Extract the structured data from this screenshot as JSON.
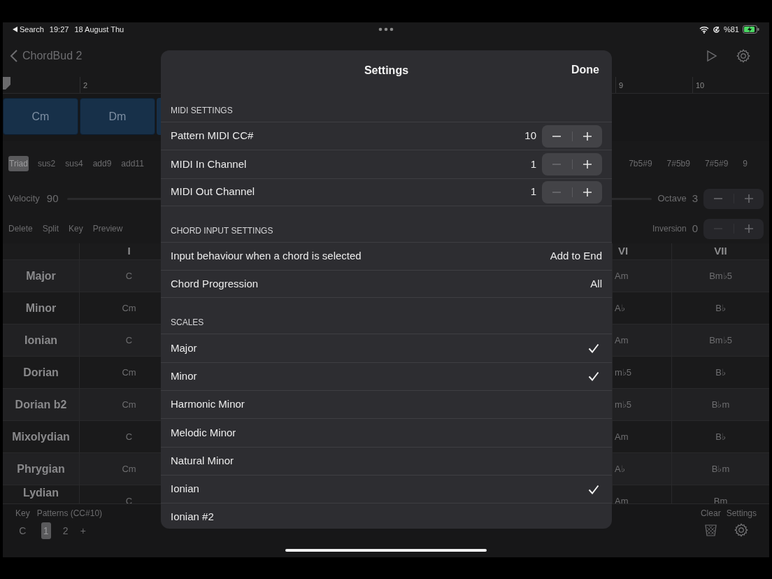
{
  "status_bar": {
    "back": "Search",
    "time": "19:27",
    "date": "18 August Thu",
    "battery": "%81"
  },
  "nav": {
    "back": "ChordBud 2"
  },
  "timeline": {
    "left_bars": [
      "2"
    ],
    "right_bars": [
      "9",
      "10"
    ],
    "chords": [
      "Cm",
      "Dm"
    ]
  },
  "chord_types_left": [
    {
      "label": "Triad",
      "selected": true
    },
    {
      "label": "sus2",
      "selected": false
    },
    {
      "label": "sus4",
      "selected": false
    },
    {
      "label": "add9",
      "selected": false
    },
    {
      "label": "add11",
      "selected": false
    }
  ],
  "chord_types_right": [
    {
      "label": "7b5#9",
      "selected": false
    },
    {
      "label": "7#5b9",
      "selected": false
    },
    {
      "label": "7#5#9",
      "selected": false
    },
    {
      "label": "9",
      "selected": false
    }
  ],
  "velocity": {
    "label": "Velocity",
    "value": "90"
  },
  "octave": {
    "label": "Octave",
    "value": "3",
    "minus_disabled": false
  },
  "inversion": {
    "label": "Inversion",
    "value": "0",
    "minus_disabled": true
  },
  "edit_actions": [
    "Delete",
    "Split",
    "Key",
    "Preview"
  ],
  "table": {
    "columns_left": [
      "I"
    ],
    "columns_right": [
      "VI",
      "VII"
    ],
    "rows": [
      {
        "name": "Major",
        "left": [
          "C"
        ],
        "right": [
          "Am",
          "Bm♭5"
        ]
      },
      {
        "name": "Minor",
        "left": [
          "Cm"
        ],
        "right": [
          "A♭",
          "B♭"
        ]
      },
      {
        "name": "Ionian",
        "left": [
          "C"
        ],
        "right": [
          "Am",
          "Bm♭5"
        ]
      },
      {
        "name": "Dorian",
        "left": [
          "Cm"
        ],
        "right": [
          "m♭5",
          "B♭"
        ]
      },
      {
        "name": "Dorian b2",
        "left": [
          "Cm"
        ],
        "right": [
          "m♭5",
          "B♭m"
        ]
      },
      {
        "name": "Mixolydian",
        "left": [
          "C"
        ],
        "right": [
          "Am",
          "B♭"
        ]
      },
      {
        "name": "Phrygian",
        "left": [
          "Cm"
        ],
        "right": [
          "A♭",
          "B♭m"
        ]
      },
      {
        "name": "Lydian",
        "left": [
          "C"
        ],
        "right": [
          "Am",
          "Bm"
        ]
      }
    ]
  },
  "bottom_bar": {
    "key_label": "Key",
    "key": "C",
    "patterns_label": "Patterns (CC#10)",
    "patterns": [
      {
        "label": "1",
        "selected": true
      },
      {
        "label": "2",
        "selected": false
      }
    ],
    "add": "+",
    "clear": "Clear",
    "settings": "Settings"
  },
  "settings_sheet": {
    "title": "Settings",
    "done": "Done",
    "sections": [
      {
        "header": "MIDI SETTINGS",
        "rows": [
          {
            "kind": "stepper",
            "label": "Pattern MIDI CC#",
            "value": "10",
            "minus_disabled": false
          },
          {
            "kind": "stepper",
            "label": "MIDI In Channel",
            "value": "1",
            "minus_disabled": true
          },
          {
            "kind": "stepper",
            "label": "MIDI Out Channel",
            "value": "1",
            "minus_disabled": true
          }
        ]
      },
      {
        "header": "CHORD INPUT SETTINGS",
        "rows": [
          {
            "kind": "value",
            "label": "Input behaviour when a chord is selected",
            "value": "Add to End"
          },
          {
            "kind": "value",
            "label": "Chord Progression",
            "value": "All"
          }
        ]
      },
      {
        "header": "SCALES",
        "rows": [
          {
            "kind": "check",
            "label": "Major",
            "checked": true
          },
          {
            "kind": "check",
            "label": "Minor",
            "checked": true
          },
          {
            "kind": "check",
            "label": "Harmonic Minor",
            "checked": false
          },
          {
            "kind": "check",
            "label": "Melodic Minor",
            "checked": false
          },
          {
            "kind": "check",
            "label": "Natural Minor",
            "checked": false
          },
          {
            "kind": "check",
            "label": "Ionian",
            "checked": true
          },
          {
            "kind": "check",
            "label": "Ionian #2",
            "checked": false
          }
        ]
      }
    ]
  }
}
